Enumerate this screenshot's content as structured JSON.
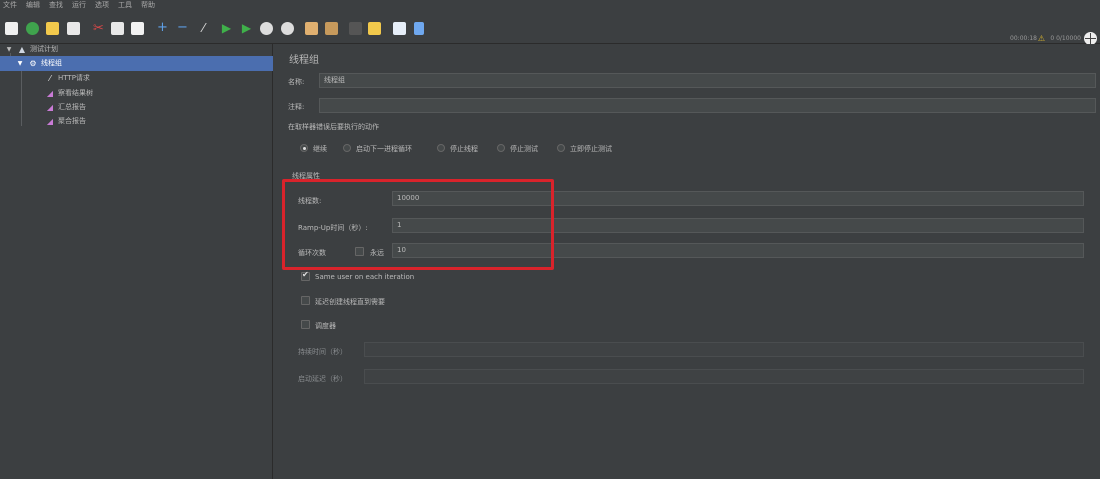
{
  "menu": [
    "文件",
    "编辑",
    "查找",
    "运行",
    "选项",
    "工具",
    "帮助"
  ],
  "toolbar": {
    "icons": [
      {
        "name": "new-icon",
        "color": "#f0f0f0"
      },
      {
        "name": "templates-icon",
        "color": "#3fa34d"
      },
      {
        "name": "open-icon",
        "color": "#f2c94c"
      },
      {
        "name": "save-icon",
        "color": "#e8e8e8"
      },
      {
        "name": "cut-icon",
        "color": "#d94848"
      },
      {
        "name": "copy-icon",
        "color": "#e8e8e8"
      },
      {
        "name": "paste-icon",
        "color": "#f2f2f2"
      },
      {
        "name": "expand-icon",
        "color": "#5ea0e8"
      },
      {
        "name": "collapse-icon",
        "color": "#5ea0e8"
      },
      {
        "name": "toggle-icon",
        "color": "#dddddd"
      },
      {
        "name": "start-icon",
        "color": "#3fb04a"
      },
      {
        "name": "start-no-pauses-icon",
        "color": "#3fb04a"
      },
      {
        "name": "stop-icon",
        "color": "#dddddd"
      },
      {
        "name": "shutdown-icon",
        "color": "#dddddd"
      },
      {
        "name": "clear-icon",
        "color": "#e0b070"
      },
      {
        "name": "clear-all-icon",
        "color": "#c79a5c"
      },
      {
        "name": "search-icon",
        "color": "#555555"
      },
      {
        "name": "reset-search-icon",
        "color": "#f2c94c"
      },
      {
        "name": "function-helper-icon",
        "color": "#e6eef8"
      },
      {
        "name": "help-icon",
        "color": "#6fa8ef"
      }
    ],
    "status_text": "00:00:18",
    "warning_icon": "warning-icon",
    "counter_text": "0 0/10000"
  },
  "tree": {
    "root_label": "测试计划",
    "selected_label": "线程组",
    "children": [
      "HTTP请求",
      "察看结果树",
      "汇总报告",
      "聚合报告"
    ]
  },
  "panel": {
    "title": "线程组",
    "name_label": "名称:",
    "name_value": "线程组",
    "comment_label": "注释:",
    "comment_value": "",
    "error_action_label": "在取样器错误后要执行的动作",
    "error_actions": [
      "继续",
      "启动下一进程循环",
      "停止线程",
      "停止测试",
      "立即停止测试"
    ],
    "error_action_selected": 0,
    "thread_props_label": "线程属性",
    "threads_label": "线程数:",
    "threads_value": "10000",
    "rampup_label": "Ramp-Up时间（秒）:",
    "rampup_value": "1",
    "loop_label": "循环次数",
    "forever_label": "永远",
    "forever_checked": false,
    "loop_value": "10",
    "same_user_label": "Same user on each iteration",
    "same_user_checked": true,
    "delay_label": "延迟创建线程直到需要",
    "delay_checked": false,
    "scheduler_label": "调度器",
    "scheduler_checked": false,
    "duration_label": "持续时间（秒）",
    "duration_value": "",
    "startup_delay_label": "启动延迟（秒）",
    "startup_delay_value": ""
  },
  "colors": {
    "background": "#3c3f41",
    "selection": "#4b6eaf",
    "highlight": "#d9232b"
  }
}
